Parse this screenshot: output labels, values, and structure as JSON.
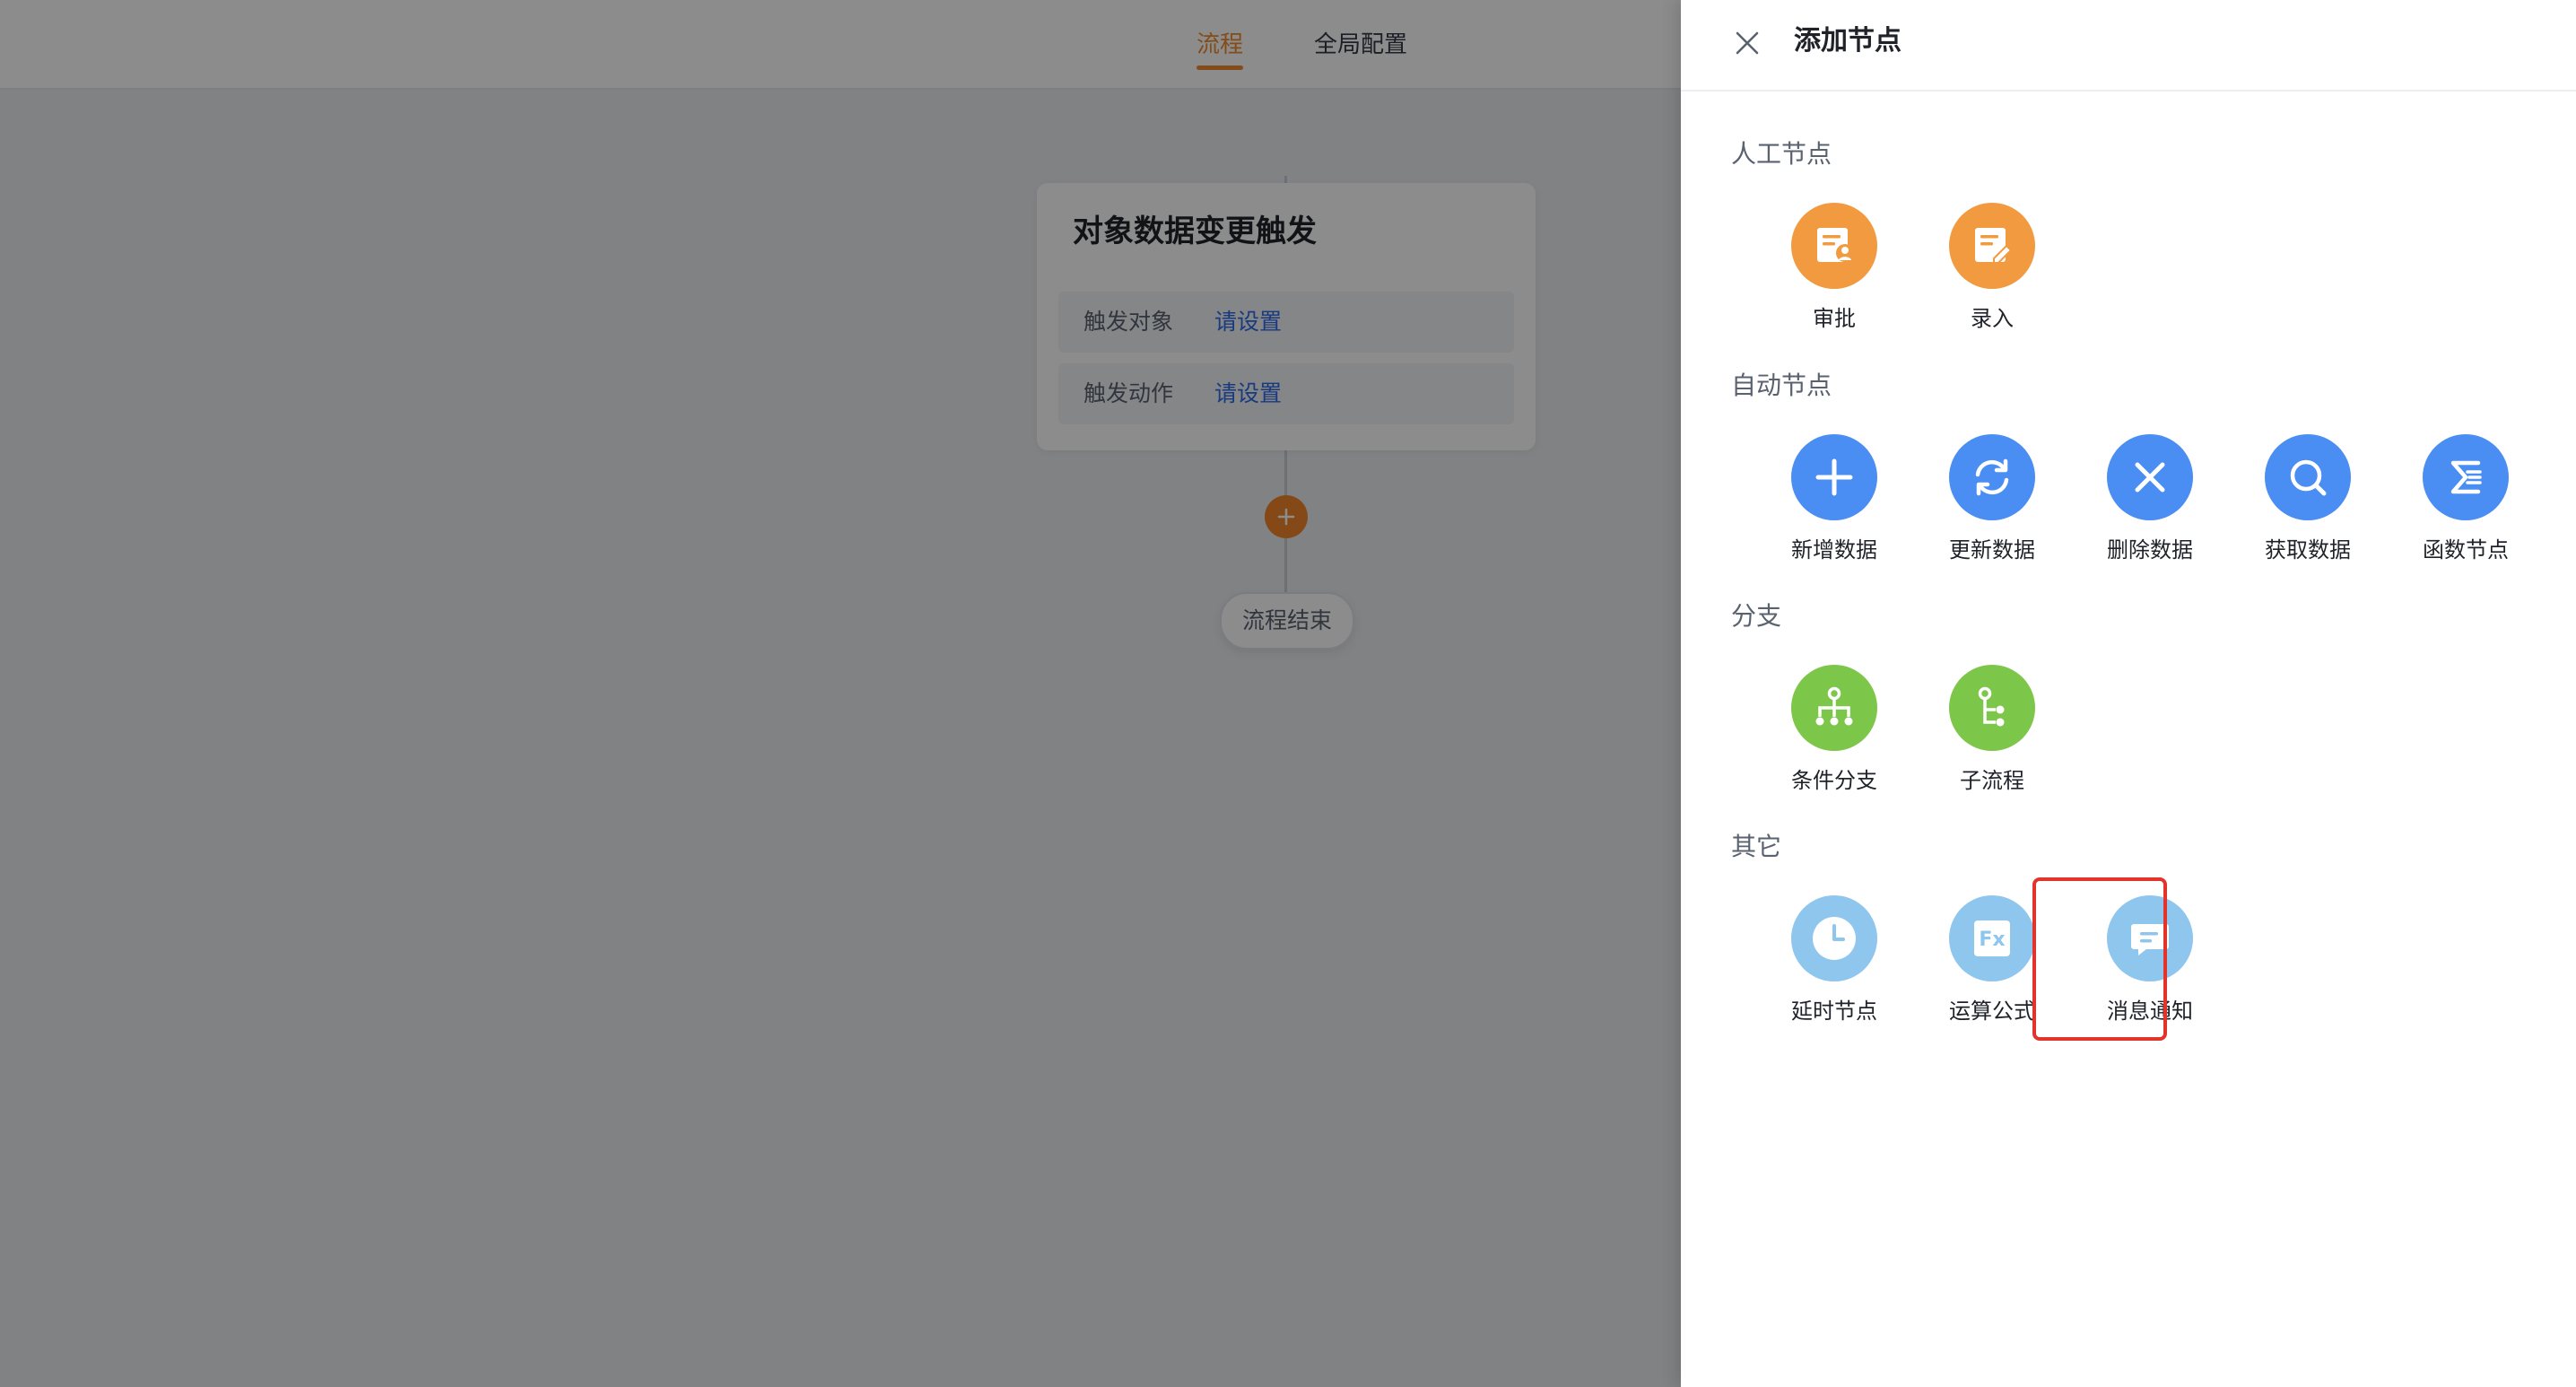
{
  "header": {
    "tabs": [
      {
        "label": "流程",
        "active": true
      },
      {
        "label": "全局配置",
        "active": false
      }
    ]
  },
  "canvas": {
    "trigger_card": {
      "title": "对象数据变更触发",
      "rows": [
        {
          "label": "触发对象",
          "link": "请设置"
        },
        {
          "label": "触发动作",
          "link": "请设置"
        }
      ]
    },
    "add_button_glyph": "+",
    "end_label": "流程结束"
  },
  "drawer": {
    "title": "添加节点",
    "sections": [
      {
        "title": "人工节点",
        "nodes": [
          {
            "label": "审批",
            "icon": "approval-icon",
            "color": "#f29a3f"
          },
          {
            "label": "录入",
            "icon": "entry-icon",
            "color": "#f29a3f"
          }
        ]
      },
      {
        "title": "自动节点",
        "nodes": [
          {
            "label": "新增数据",
            "icon": "plus-icon",
            "color": "#4a8df3"
          },
          {
            "label": "更新数据",
            "icon": "refresh-icon",
            "color": "#4a8df3"
          },
          {
            "label": "删除数据",
            "icon": "close-icon",
            "color": "#4a8df3"
          },
          {
            "label": "获取数据",
            "icon": "search-icon",
            "color": "#4a8df3"
          },
          {
            "label": "函数节点",
            "icon": "sigma-icon",
            "color": "#4a8df3"
          }
        ]
      },
      {
        "title": "分支",
        "nodes": [
          {
            "label": "条件分支",
            "icon": "branch-icon",
            "color": "#7cc64a"
          },
          {
            "label": "子流程",
            "icon": "subprocess-icon",
            "color": "#7cc64a"
          }
        ]
      },
      {
        "title": "其它",
        "nodes": [
          {
            "label": "延时节点",
            "icon": "clock-icon",
            "color": "#8ec6ee"
          },
          {
            "label": "运算公式",
            "icon": "formula-icon",
            "color": "#8ec6ee"
          },
          {
            "label": "消息通知",
            "icon": "message-icon",
            "color": "#8ec6ee",
            "highlighted": true
          }
        ]
      }
    ]
  },
  "formula_icon_text": "Fx"
}
